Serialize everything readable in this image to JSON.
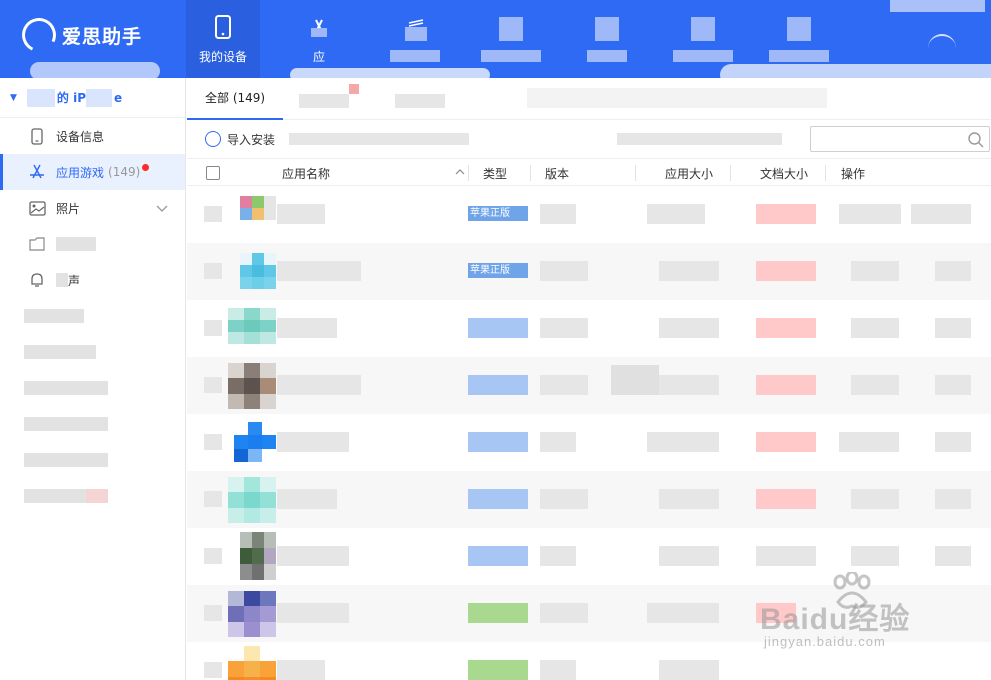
{
  "app": {
    "logo_text": "爱思助手"
  },
  "nav": {
    "items": [
      {
        "label": "我的设备",
        "icon": "phone-icon"
      },
      {
        "label": "应",
        "icon": "app-store-icon"
      },
      {
        "label": "",
        "icon": "ringtone-icon"
      },
      {
        "label": "",
        "icon": "blurred-icon"
      },
      {
        "label": "",
        "icon": "blurred-icon"
      },
      {
        "label": "",
        "icon": "blurred-icon"
      },
      {
        "label": "",
        "icon": "blurred-icon"
      }
    ]
  },
  "sidebar": {
    "device_name": "的 iP",
    "device_name_suffix": "e",
    "items": [
      {
        "label": "设备信息",
        "icon": "phone-outline-icon"
      },
      {
        "label": "应用游戏",
        "count": "(149)",
        "icon": "app-store-icon",
        "active": true
      },
      {
        "label": "照片",
        "icon": "photo-icon"
      },
      {
        "label": "",
        "icon": "folder-icon"
      },
      {
        "label": "声",
        "icon": "bell-icon"
      },
      {
        "label": "",
        "icon": "blurred"
      },
      {
        "label": "",
        "icon": "blurred"
      },
      {
        "label": "",
        "icon": "blurred"
      },
      {
        "label": "",
        "icon": "blurred"
      },
      {
        "label": "",
        "icon": "blurred"
      },
      {
        "label": "",
        "icon": "blurred"
      }
    ]
  },
  "main": {
    "tabs": [
      {
        "label": "全部 (149)",
        "active": true
      }
    ],
    "toolbar": {
      "import_label": "导入安装"
    },
    "search": {
      "placeholder": ""
    },
    "table": {
      "columns": [
        "应用名称",
        "类型",
        "版本",
        "应用大小",
        "文档大小",
        "操作"
      ],
      "type_tag": "苹果正版",
      "rows": [
        {
          "tag": "苹果正版",
          "tag_color": "#6fa4e8"
        },
        {
          "tag": "苹果正版",
          "tag_color": "#6fa4e8"
        },
        {
          "tag": "",
          "tag_color": "#a7c6f3"
        },
        {
          "tag": "",
          "tag_color": "#a7c6f3"
        },
        {
          "tag": "",
          "tag_color": "#a7c6f3"
        },
        {
          "tag": "",
          "tag_color": "#a7c6f3"
        },
        {
          "tag": "",
          "tag_color": "#a7c6f3"
        },
        {
          "tag": "",
          "tag_color": "#a8d98f"
        },
        {
          "tag": "",
          "tag_color": "#a8d98f"
        }
      ]
    }
  },
  "watermark": {
    "text": "Baidu经验",
    "sub": "jingyan.baidu.com"
  },
  "colors": {
    "brand": "#2f6af4",
    "active_bg": "#e9f0fe",
    "badge": "#ff2a2a"
  }
}
